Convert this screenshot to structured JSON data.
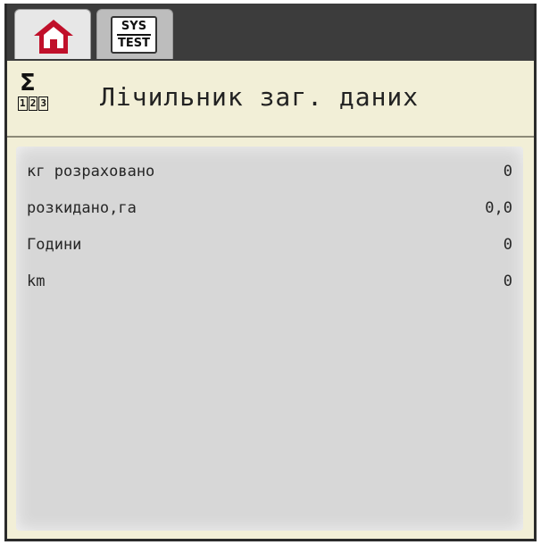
{
  "tabs": [
    {
      "name": "home",
      "icon": "home-icon",
      "active": true,
      "color": "#c0102a"
    },
    {
      "name": "sys-test",
      "icon": "sys-test-icon",
      "label_top": "SYS",
      "label_bottom": "TEST"
    }
  ],
  "header": {
    "icon": "sum-counter-icon",
    "icon_symbol": "Σ",
    "icon_digits": [
      "1",
      "2",
      "3"
    ],
    "title": "Лічильник заг. даних"
  },
  "counters": [
    {
      "label": "кг розраховано",
      "value": "0"
    },
    {
      "label": "розкидано,га",
      "value": "0,0"
    },
    {
      "label": "Години",
      "value": "0"
    },
    {
      "label": "km",
      "value": "0"
    }
  ]
}
